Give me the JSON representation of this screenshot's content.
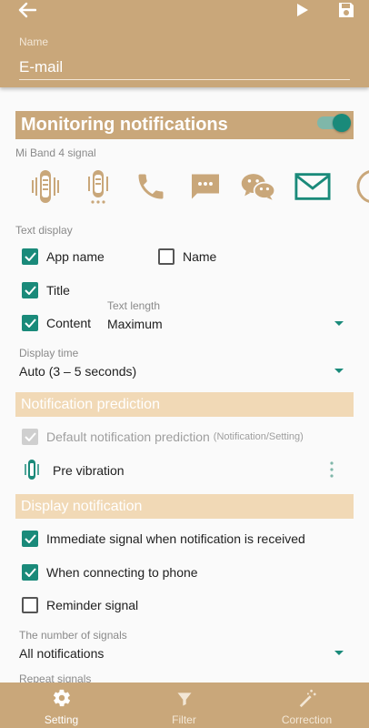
{
  "header": {
    "name_label": "Name",
    "name_value": "E-mail"
  },
  "monitoring": {
    "title": "Monitoring notifications",
    "enabled": true,
    "signal_caption": "Mi Band 4 signal",
    "icons": [
      "vibration-band-icon",
      "vibration-band-dots-icon",
      "phone-icon",
      "sms-icon",
      "wechat-icon",
      "mail-icon",
      "partial-icon"
    ]
  },
  "text_display": {
    "caption": "Text display",
    "app_name": "App name",
    "name": "Name",
    "title": "Title",
    "content": "Content",
    "text_length_label": "Text length",
    "text_length_value": "Maximum",
    "display_time_label": "Display time",
    "display_time_value": "Auto (3 – 5 seconds)"
  },
  "prediction": {
    "title": "Notification prediction",
    "default_label": "Default notification prediction",
    "default_suffix": "(Notification/Setting)",
    "pre_vibration": "Pre vibration"
  },
  "display": {
    "title": "Display notification",
    "immediate": "Immediate signal when notification is received",
    "connecting": "When connecting to phone",
    "reminder": "Reminder signal",
    "signals_label": "The number of signals",
    "signals_value": "All notifications",
    "repeat_label": "Repeat signals"
  },
  "tabs": [
    {
      "label": "Setting"
    },
    {
      "label": "Filter"
    },
    {
      "label": "Correction"
    }
  ],
  "colors": {
    "primary": "#c9a77a",
    "accent": "#1a8a7a",
    "light": "#f1d9b6"
  }
}
